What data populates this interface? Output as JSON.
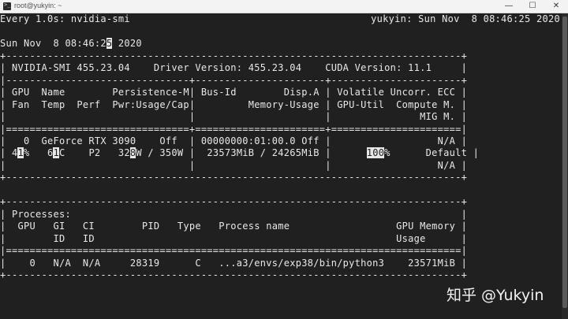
{
  "window": {
    "title": "root@yukyin: ~",
    "min_glyph": "—",
    "max_glyph": "☐",
    "close_glyph": "✕"
  },
  "terminal": {
    "watch_header_left": "Every 1.0s: nvidia-smi",
    "watch_header_right": "yukyin: Sun Nov  8 08:46:25 2020",
    "date_pre": "Sun Nov  8 08:46:2",
    "date_cursor": "5",
    "date_post": " 2020",
    "border": "+-----------------------------------------------------------------------------+",
    "version_line": "| NVIDIA-SMI 455.23.04    Driver Version: 455.23.04    CUDA Version: 11.1     |",
    "sep_dash": "|-------------------------------+----------------------+----------------------+",
    "header_1": "| GPU  Name        Persistence-M| Bus-Id        Disp.A | Volatile Uncorr. ECC |",
    "header_2": "| Fan  Temp  Perf  Pwr:Usage/Cap|         Memory-Usage | GPU-Util  Compute M. |",
    "header_3": "|                               |                      |               MIG M. |",
    "sep_equals": "|===============================+======================+======================|",
    "gpu_line_1": "|   0  GeForce RTX 3090    Off  | 00000000:01:00.0 Off |                  N/A |",
    "gpu_line_2": {
      "p1": "| 4",
      "c1": "1",
      "p2": "%   6",
      "c2": "1",
      "p3": "C    P2   32",
      "c3": "8",
      "p4": "W / 350W |  23573MiB / 24265MiB |      ",
      "c4": "100",
      "p5": "%      Default |"
    },
    "gpu_line_3": "|                               |                      |                  N/A |",
    "blank_separator": "",
    "proc_title": "| Processes:                                                                  |",
    "proc_header_1": "|  GPU   GI   CI        PID   Type   Process name                  GPU Memory |",
    "proc_header_2": "|        ID   ID                                                   Usage      |",
    "proc_sep": "|=============================================================================|",
    "proc_line": "|    0   N/A  N/A     28319      C   ...a3/envs/exp38/bin/python3    23571MiB |",
    "dash_bottom": "+-----------------------------------------------------------------------------+"
  },
  "watermark": "知乎 @Yukyin"
}
